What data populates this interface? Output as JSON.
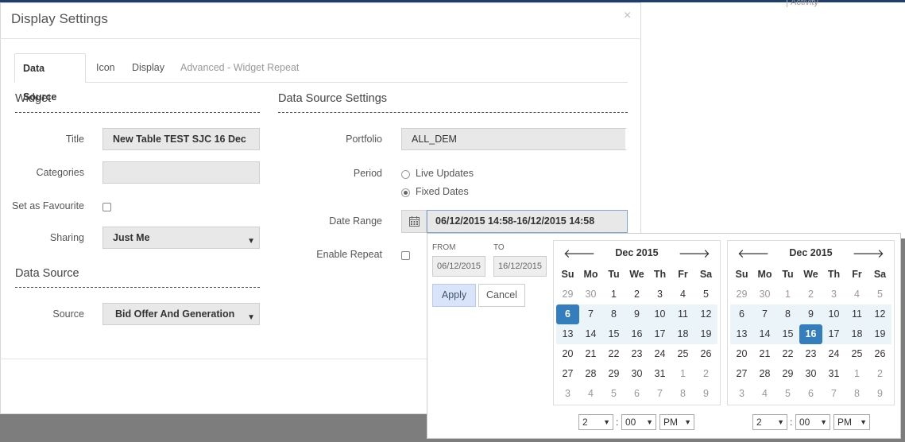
{
  "modal": {
    "title": "Display Settings",
    "close": "×"
  },
  "tabs": [
    {
      "label": "Data Source",
      "state": "active"
    },
    {
      "label": "Icon",
      "state": "normal"
    },
    {
      "label": "Display",
      "state": "normal"
    },
    {
      "label": "Advanced - Widget Repeat",
      "state": "disabled"
    }
  ],
  "widget": {
    "section": "Widget",
    "title_label": "Title",
    "title_value": "New Table TEST SJC 16 Dec",
    "categories_label": "Categories",
    "categories_value": "",
    "favourite_label": "Set as Favourite",
    "sharing_label": "Sharing",
    "sharing_value": "Just Me"
  },
  "datasource": {
    "section": "Data Source",
    "source_label": "Source",
    "source_value": "Bid Offer And Generation"
  },
  "settings": {
    "section": "Data Source Settings",
    "portfolio_label": "Portfolio",
    "portfolio_value": "ALL_DEM",
    "period_label": "Period",
    "period_options": [
      "Live Updates",
      "Fixed Dates"
    ],
    "period_selected": "Fixed Dates",
    "daterange_label": "Date Range",
    "daterange_value": "06/12/2015 14:58-16/12/2015 14:58",
    "repeat_label": "Enable Repeat"
  },
  "picker": {
    "from_label": "FROM",
    "from_value": "06/12/2015",
    "to_label": "TO",
    "to_value": "16/12/2015",
    "apply": "Apply",
    "cancel": "Cancel",
    "dow": [
      "Su",
      "Mo",
      "Tu",
      "We",
      "Th",
      "Fr",
      "Sa"
    ],
    "prev_icon": "arrow-left-icon",
    "next_icon": "arrow-right-icon",
    "calendars": [
      {
        "month": "Dec 2015",
        "weeks": [
          [
            "29",
            "30",
            "1",
            "2",
            "3",
            "4",
            "5"
          ],
          [
            "6",
            "7",
            "8",
            "9",
            "10",
            "11",
            "12"
          ],
          [
            "13",
            "14",
            "15",
            "16",
            "17",
            "18",
            "19"
          ],
          [
            "20",
            "21",
            "22",
            "23",
            "24",
            "25",
            "26"
          ],
          [
            "27",
            "28",
            "29",
            "30",
            "31",
            "1",
            "2"
          ],
          [
            "3",
            "4",
            "5",
            "6",
            "7",
            "8",
            "9"
          ]
        ],
        "off": [
          [
            0,
            0
          ],
          [
            0,
            1
          ],
          [
            4,
            5
          ],
          [
            4,
            6
          ],
          [
            5,
            0
          ],
          [
            5,
            1
          ],
          [
            5,
            2
          ],
          [
            5,
            3
          ],
          [
            5,
            4
          ],
          [
            5,
            5
          ],
          [
            5,
            6
          ]
        ],
        "selected": [
          [
            1,
            0
          ]
        ],
        "inrange_rows": [
          1,
          2
        ],
        "hour": "2",
        "minute": "00",
        "ampm": "PM"
      },
      {
        "month": "Dec 2015",
        "weeks": [
          [
            "29",
            "30",
            "1",
            "2",
            "3",
            "4",
            "5"
          ],
          [
            "6",
            "7",
            "8",
            "9",
            "10",
            "11",
            "12"
          ],
          [
            "13",
            "14",
            "15",
            "16",
            "17",
            "18",
            "19"
          ],
          [
            "20",
            "21",
            "22",
            "23",
            "24",
            "25",
            "26"
          ],
          [
            "27",
            "28",
            "29",
            "30",
            "31",
            "1",
            "2"
          ],
          [
            "3",
            "4",
            "5",
            "6",
            "7",
            "8",
            "9"
          ]
        ],
        "off": [
          [
            0,
            0
          ],
          [
            0,
            1
          ],
          [
            0,
            2
          ],
          [
            0,
            3
          ],
          [
            0,
            4
          ],
          [
            0,
            5
          ],
          [
            0,
            6
          ],
          [
            4,
            5
          ],
          [
            4,
            6
          ],
          [
            5,
            0
          ],
          [
            5,
            1
          ],
          [
            5,
            2
          ],
          [
            5,
            3
          ],
          [
            5,
            4
          ],
          [
            5,
            5
          ],
          [
            5,
            6
          ]
        ],
        "selected": [
          [
            2,
            3
          ]
        ],
        "inrange_rows": [
          1,
          2
        ],
        "hour": "2",
        "minute": "00",
        "ampm": "PM"
      }
    ]
  },
  "background": {
    "fragment": "Activity"
  }
}
